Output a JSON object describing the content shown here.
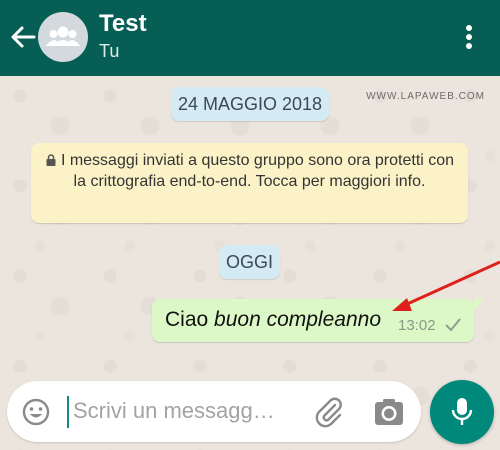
{
  "header": {
    "title": "Test",
    "subtitle": "Tu"
  },
  "watermark": "WWW.LAPAWEB.COM",
  "chat": {
    "date_chip": "24 MAGGIO 2018",
    "encryption_notice": "I messaggi inviati a questo gruppo sono ora protetti con la crittografia end-to-end. Tocca per maggiori info.",
    "today_chip": "OGGI",
    "message": {
      "text_plain": "Ciao ",
      "text_italic": "buon compleanno",
      "time": "13:02",
      "status_icon": "single-check-icon"
    }
  },
  "composer": {
    "placeholder": "Scrivi un messagg…"
  },
  "icons": {
    "back": "arrow-left-icon",
    "avatar": "group-avatar-icon",
    "menu": "more-vertical-icon",
    "emoji": "emoji-icon",
    "attach": "paperclip-icon",
    "camera": "camera-icon",
    "mic": "microphone-icon"
  },
  "colors": {
    "header": "#075e54",
    "outgoing_bubble": "#dcf8c6",
    "notice_bubble": "#fbf3c7",
    "date_chip": "#d4eaf4",
    "mic_button": "#00897b",
    "annotation_arrow": "#e0201c"
  }
}
